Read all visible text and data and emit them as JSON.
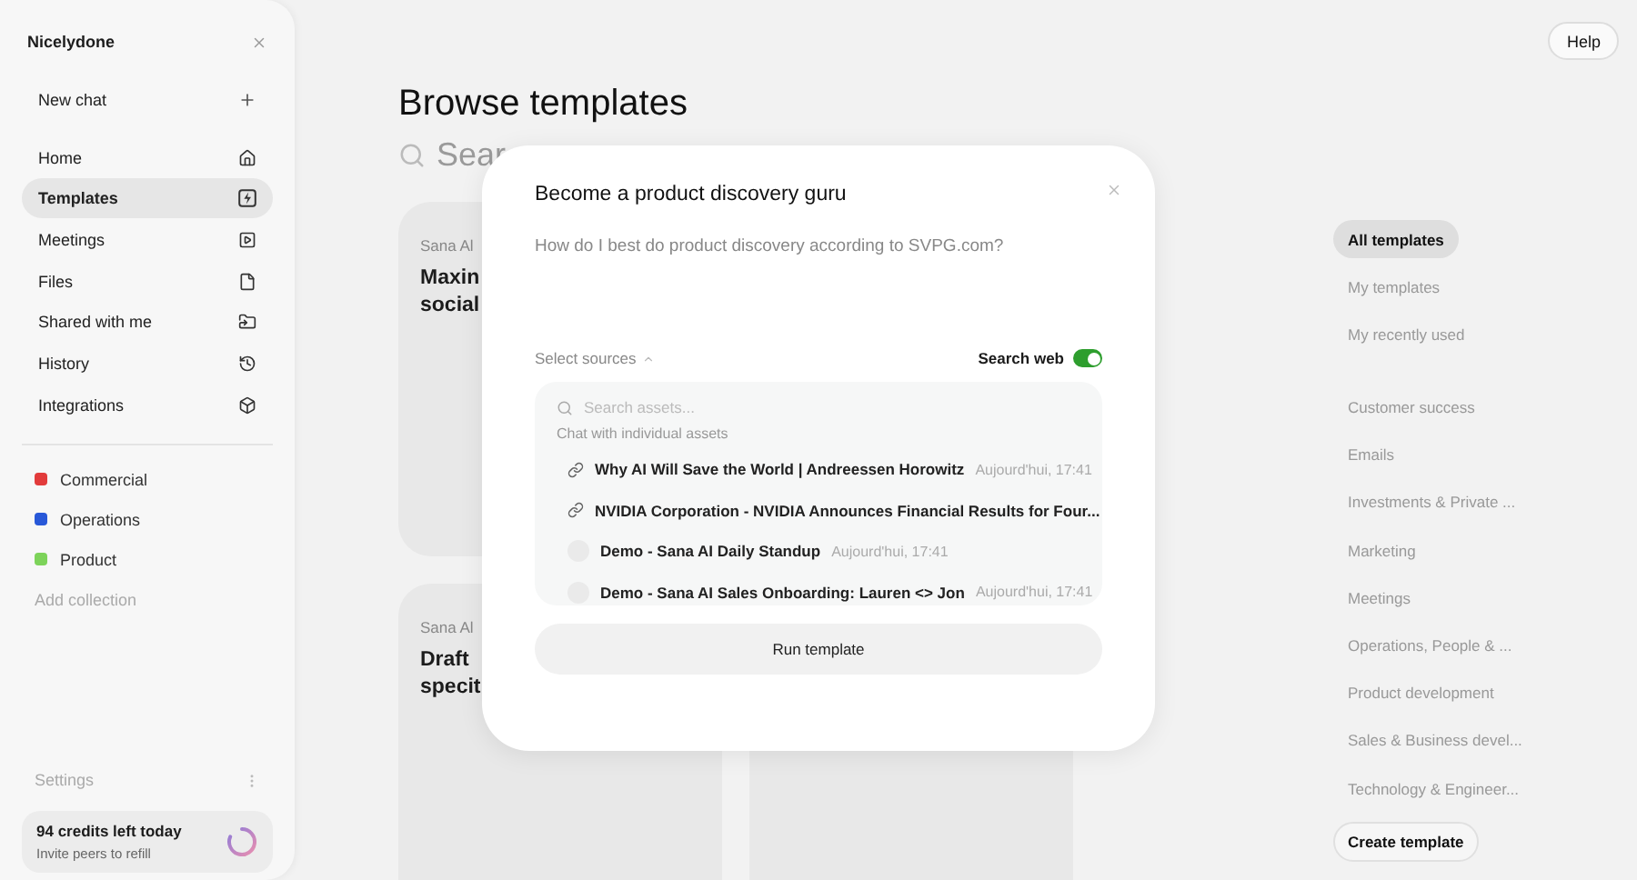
{
  "sidebar": {
    "workspace": "Nicelydone",
    "new_chat": "New chat",
    "nav": [
      {
        "label": "Home",
        "selected": false
      },
      {
        "label": "Templates",
        "selected": true
      },
      {
        "label": "Meetings",
        "selected": false
      },
      {
        "label": "Files",
        "selected": false
      },
      {
        "label": "Shared with me",
        "selected": false
      },
      {
        "label": "History",
        "selected": false
      },
      {
        "label": "Integrations",
        "selected": false
      }
    ],
    "collections": [
      {
        "label": "Commercial",
        "color": "#e23b3b"
      },
      {
        "label": "Operations",
        "color": "#2858d8"
      },
      {
        "label": "Product",
        "color": "#7dd35a"
      }
    ],
    "add_collection": "Add collection",
    "settings": "Settings",
    "credits": {
      "title": "94 credits left today",
      "subtitle": "Invite peers to refill"
    }
  },
  "help": "Help",
  "main": {
    "title": "Browse templates",
    "search_placeholder": "Sear",
    "cards": [
      {
        "kind": "text",
        "author": "Sana Al",
        "title": "Maxin social"
      },
      {
        "kind": "text",
        "author": "Sana Al",
        "title": "Draft specit"
      },
      {
        "kind": "blank"
      }
    ]
  },
  "filters": {
    "groups": [
      [
        {
          "label": "All templates",
          "selected": true
        },
        {
          "label": "My templates",
          "selected": false
        },
        {
          "label": "My recently used",
          "selected": false
        }
      ],
      [
        {
          "label": "Customer success",
          "selected": false
        },
        {
          "label": "Emails",
          "selected": false
        },
        {
          "label": "Investments & Private ...",
          "selected": false
        },
        {
          "label": "Marketing",
          "selected": false
        },
        {
          "label": "Meetings",
          "selected": false
        },
        {
          "label": "Operations, People & ...",
          "selected": false
        },
        {
          "label": "Product development",
          "selected": false
        },
        {
          "label": "Sales & Business devel...",
          "selected": false
        },
        {
          "label": "Technology & Engineer...",
          "selected": false
        }
      ]
    ],
    "create": "Create template"
  },
  "modal": {
    "title": "Become a product discovery guru",
    "prompt": "How do I best do product discovery according to SVPG.com?",
    "select_sources": "Select sources",
    "search_web": {
      "label": "Search web",
      "on": true
    },
    "assets": {
      "placeholder": "Search assets...",
      "section": "Chat with individual assets",
      "items": [
        {
          "kind": "link",
          "title": "Why AI Will Save the World | Andreessen Horowitz",
          "time": "Aujourd'hui, 17:41"
        },
        {
          "kind": "link",
          "title": "NVIDIA Corporation - NVIDIA Announces Financial Results for Four..."
        },
        {
          "kind": "meeting",
          "title": "Demo - Sana AI Daily Standup",
          "time": "Aujourd'hui, 17:41"
        },
        {
          "kind": "meeting",
          "title": "Demo - Sana AI Sales Onboarding: Lauren <> Jon",
          "time": "Aujourd'hui, 17:41"
        }
      ]
    },
    "run": "Run template"
  }
}
